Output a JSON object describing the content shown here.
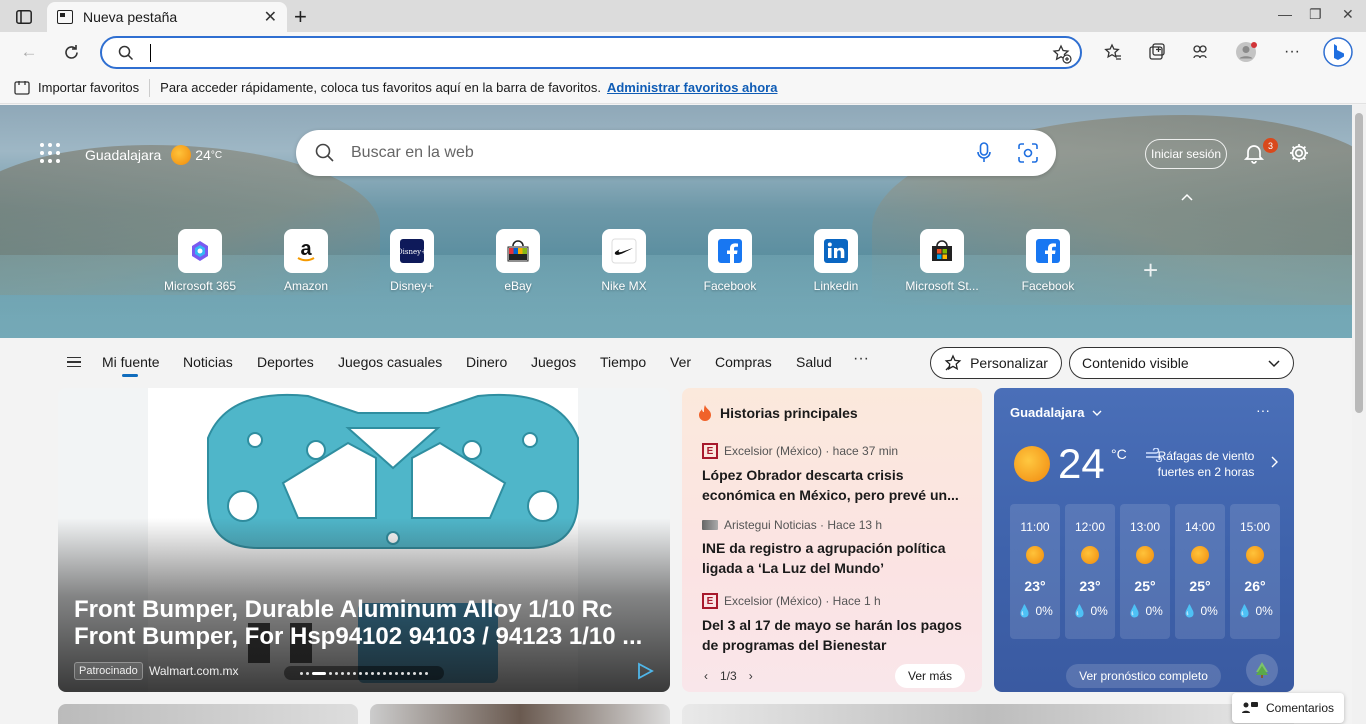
{
  "browser": {
    "tab_title": "Nueva pestaña",
    "favorites_bar": {
      "import_label": "Importar favoritos",
      "message": "Para acceder rápidamente, coloca tus favoritos aquí en la barra de favoritos.",
      "manage_link": "Administrar favoritos ahora"
    }
  },
  "header": {
    "location": "Guadalajara",
    "temperature": "24",
    "temp_unit": "°C",
    "search_placeholder": "Buscar en la web",
    "signin_label": "Iniciar sesión",
    "notifications_count": "3"
  },
  "quick_links": [
    {
      "label": "Microsoft 365",
      "icon": "microsoft-365-icon"
    },
    {
      "label": "Amazon",
      "icon": "amazon-icon"
    },
    {
      "label": "Disney+",
      "icon": "disney-plus-icon"
    },
    {
      "label": "eBay",
      "icon": "ebay-icon"
    },
    {
      "label": "Nike MX",
      "icon": "nike-icon"
    },
    {
      "label": "Facebook",
      "icon": "facebook-icon"
    },
    {
      "label": "Linkedin",
      "icon": "linkedin-icon"
    },
    {
      "label": "Microsoft St...",
      "icon": "microsoft-store-icon"
    },
    {
      "label": "Facebook",
      "icon": "facebook-icon"
    }
  ],
  "nav": {
    "items": [
      "Mi fuente",
      "Noticias",
      "Deportes",
      "Juegos casuales",
      "Dinero",
      "Juegos",
      "Tiempo",
      "Ver",
      "Compras",
      "Salud"
    ],
    "more": "···",
    "personalize_label": "Personalizar",
    "content_visible_label": "Contenido visible"
  },
  "promo": {
    "headline_line1": "Front Bumper, Durable Aluminum Alloy 1/10 Rc",
    "headline_line2": "Front Bumper, For Hsp94102 94103 / 94123 1/10 ...",
    "sponsored": "Patrocinado",
    "source": "Walmart.com.mx"
  },
  "top_stories": {
    "title": "Historias principales",
    "stories": [
      {
        "source": "Excelsior (México) · hace 37 min",
        "title": "López Obrador descarta crisis económica en México, pero prevé un..."
      },
      {
        "source": "Aristegui Noticias · Hace 13 h",
        "title": "INE da registro a agrupación política ligada a ‘La Luz del Mundo’"
      },
      {
        "source": "Excelsior (México) · Hace 1 h",
        "title": "Del 3 al 17 de mayo se harán los pagos de programas del Bienestar"
      }
    ],
    "pager": "1/3",
    "more_label": "Ver más"
  },
  "weather": {
    "city": "Guadalajara",
    "temp": "24",
    "unit": "°C",
    "alert": "Ráfagas de viento fuertes en 2 horas",
    "hours": [
      {
        "time": "11:00",
        "temp": "23°",
        "precip": "0%"
      },
      {
        "time": "12:00",
        "temp": "23°",
        "precip": "0%"
      },
      {
        "time": "13:00",
        "temp": "25°",
        "precip": "0%"
      },
      {
        "time": "14:00",
        "temp": "25°",
        "precip": "0%"
      },
      {
        "time": "15:00",
        "temp": "26°",
        "precip": "0%"
      }
    ],
    "forecast_label": "Ver pronóstico completo"
  },
  "feedback_label": "Comentarios",
  "colors": {
    "accent": "#0f6cbd",
    "address_border": "#2f6fd1",
    "weather_card": "#4a6fb8",
    "badge": "#d9491c"
  }
}
